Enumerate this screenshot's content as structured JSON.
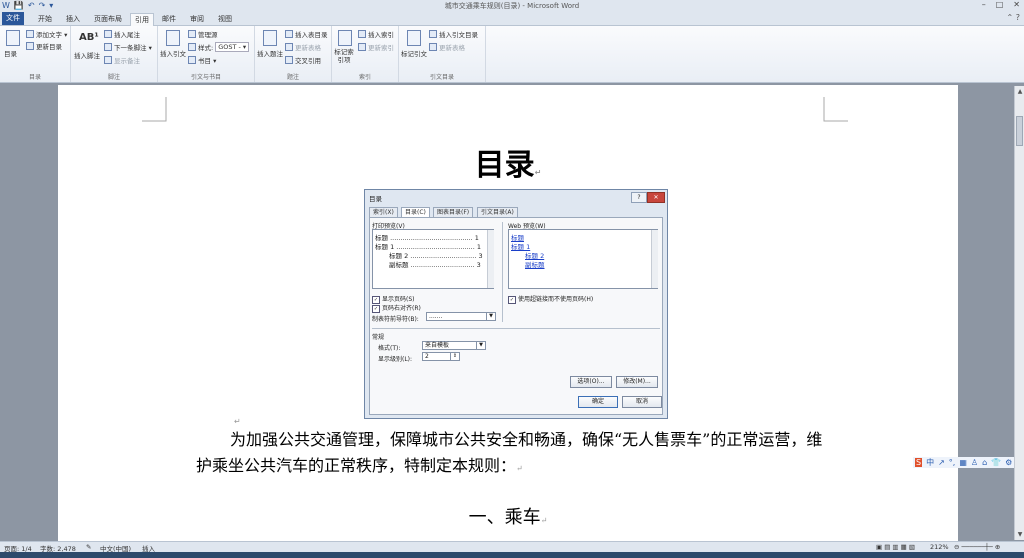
{
  "window": {
    "title": "城市交通乘车规则(目录) - Microsoft Word",
    "quick_access": [
      "W",
      "💾",
      "↶",
      "↷",
      "▾"
    ],
    "controls": [
      "–",
      "□",
      "✕"
    ]
  },
  "tabs": [
    {
      "label": "文件",
      "kind": "file"
    },
    {
      "label": "开始"
    },
    {
      "label": "插入"
    },
    {
      "label": "页面布局"
    },
    {
      "label": "引用",
      "active": true
    },
    {
      "label": "邮件"
    },
    {
      "label": "审阅"
    },
    {
      "label": "视图"
    }
  ],
  "ribbon": {
    "toc_group": {
      "label": "目录",
      "big": "目录",
      "add_text": "添加文字 ▾",
      "update_toc": "更新目录"
    },
    "footnote_group": {
      "label": "脚注",
      "big": "插入脚注",
      "insert_endnote": "插入尾注",
      "next_footnote": "下一条脚注 ▾",
      "show_notes": "显示备注"
    },
    "citation_group": {
      "label": "引文与书目",
      "big": "插入引文",
      "manage_sources": "管理源",
      "style_label": "样式:",
      "style_value": "GOST - ▾",
      "bibliography": "书目 ▾"
    },
    "caption_group": {
      "label": "题注",
      "big": "插入题注",
      "insert_tof": "插入表目录",
      "update_table": "更新表格",
      "cross_ref": "交叉引用"
    },
    "index_group": {
      "label": "索引",
      "big": "标记索引项",
      "insert_index": "插入索引",
      "update_index": "更新索引"
    },
    "toa_group": {
      "label": "引文目录",
      "big": "标记引文",
      "insert_toa": "插入引文目录",
      "update_toa": "更新表格"
    }
  },
  "document": {
    "title": "目录",
    "paragraph": "为加强公共交通管理，保障城市公共安全和畅通，确保“无人售票车”的正常运营，维护乘坐公共汽车的正常秩序，特制定本规则：",
    "heading1": "一、乘车"
  },
  "dialog": {
    "title": "目录",
    "help": "?",
    "close": "✕",
    "tabs": [
      "索引(X)",
      "目录(C)",
      "图表目录(F)",
      "引文目录(A)"
    ],
    "print_preview_label": "打印预览(V)",
    "print_preview": [
      {
        "text": "标题 ........................................ 1",
        "indent": 0
      },
      {
        "text": "标题 1 ...................................... 1",
        "indent": 0
      },
      {
        "text": "标题 2 ................................ 3",
        "indent": 1
      },
      {
        "text": "副标题 ............................... 3",
        "indent": 1
      }
    ],
    "web_preview_label": "Web 预览(W)",
    "web_preview": [
      {
        "text": "标题",
        "indent": 0
      },
      {
        "text": "标题 1",
        "indent": 0
      },
      {
        "text": "标题 2",
        "indent": 1
      },
      {
        "text": "副标题",
        "indent": 1
      }
    ],
    "show_page_numbers": "显示页码(S)",
    "right_align": "页码右对齐(R)",
    "tab_leader_label": "制表符前导符(B):",
    "tab_leader_value": ".......",
    "use_hyperlinks": "使用超链接而不使用页码(H)",
    "general_label": "常规",
    "formats_label": "格式(T):",
    "formats_value": "来自模板",
    "levels_label": "显示级别(L):",
    "levels_value": "2",
    "options_button": "选项(O)...",
    "modify_button": "修改(M)...",
    "ok_button": "确定",
    "cancel_button": "取消"
  },
  "ime": [
    "S",
    "中",
    "↗",
    "°,",
    "▦",
    "♙",
    "⌂",
    "👕",
    "⚙"
  ],
  "status": {
    "page": "页面: 1/4",
    "words": "字数: 2,478",
    "language": "中文(中国)",
    "mode": "插入",
    "zoom": "212%"
  }
}
